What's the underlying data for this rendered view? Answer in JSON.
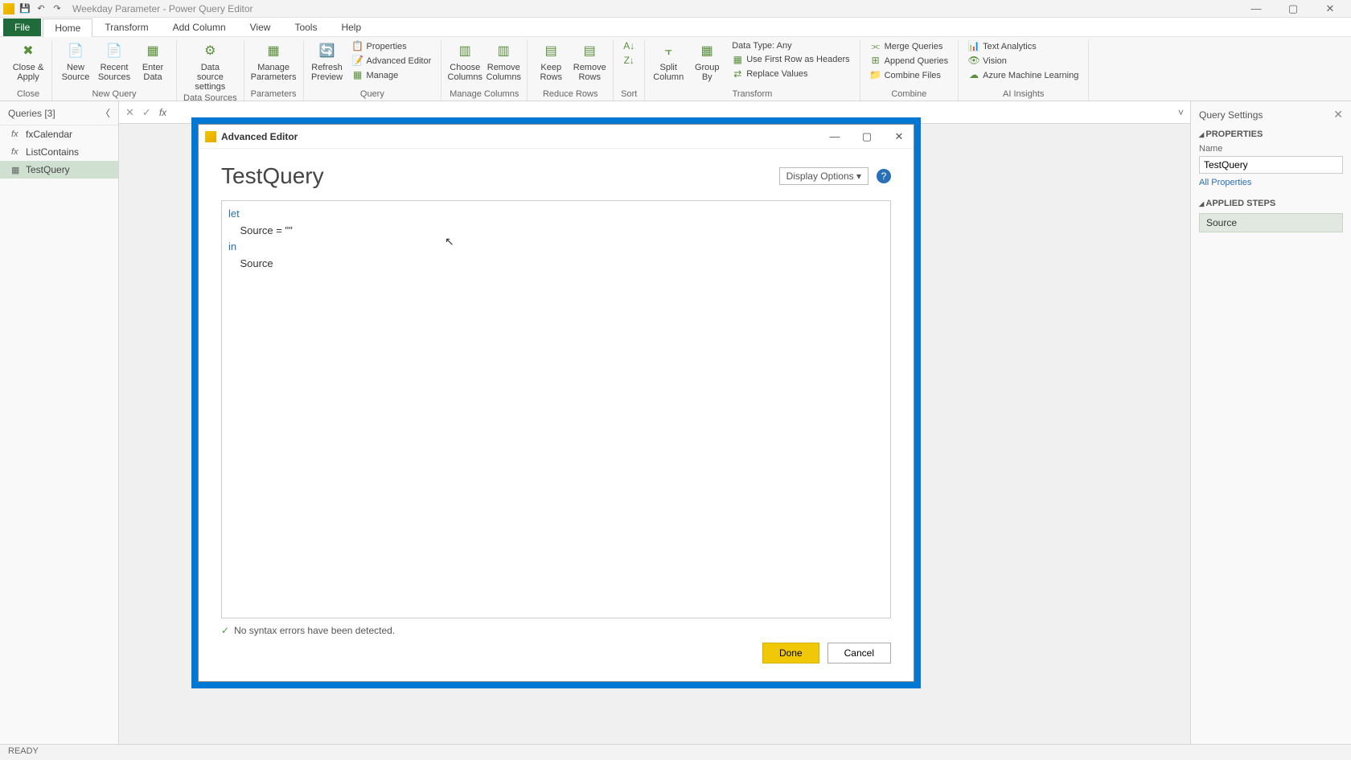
{
  "titlebar": {
    "title": "Weekday Parameter - Power Query Editor"
  },
  "tabs": {
    "file": "File",
    "home": "Home",
    "transform": "Transform",
    "addcolumn": "Add Column",
    "view": "View",
    "tools": "Tools",
    "help": "Help"
  },
  "ribbon": {
    "close_apply": "Close &\nApply",
    "new_source": "New\nSource",
    "recent_sources": "Recent\nSources",
    "enter_data": "Enter\nData",
    "data_source_settings": "Data source\nsettings",
    "manage_parameters": "Manage\nParameters",
    "refresh_preview": "Refresh\nPreview",
    "properties": "Properties",
    "advanced_editor": "Advanced Editor",
    "manage": "Manage",
    "choose_columns": "Choose\nColumns",
    "remove_columns": "Remove\nColumns",
    "keep_rows": "Keep\nRows",
    "remove_rows": "Remove\nRows",
    "sort_group": "Sort",
    "split_column": "Split\nColumn",
    "group_by": "Group\nBy",
    "data_type": "Data Type: Any",
    "first_row_headers": "Use First Row as Headers",
    "replace_values": "Replace Values",
    "merge_queries": "Merge Queries",
    "append_queries": "Append Queries",
    "combine_files": "Combine Files",
    "text_analytics": "Text Analytics",
    "vision": "Vision",
    "azure_ml": "Azure Machine Learning",
    "groups": {
      "close": "Close",
      "new_query": "New Query",
      "data_sources": "Data Sources",
      "parameters": "Parameters",
      "query": "Query",
      "manage_columns": "Manage Columns",
      "reduce_rows": "Reduce Rows",
      "sort": "Sort",
      "transform": "Transform",
      "combine": "Combine",
      "ai_insights": "AI Insights"
    }
  },
  "queries": {
    "header": "Queries [3]",
    "items": [
      {
        "name": "fxCalendar",
        "type": "fx"
      },
      {
        "name": "ListContains",
        "type": "fx"
      },
      {
        "name": "TestQuery",
        "type": "table"
      }
    ]
  },
  "settings": {
    "title": "Query Settings",
    "properties": "PROPERTIES",
    "name_label": "Name",
    "name_value": "TestQuery",
    "all_properties": "All Properties",
    "applied_steps": "APPLIED STEPS",
    "step0": "Source"
  },
  "dialog": {
    "title": "Advanced Editor",
    "heading": "TestQuery",
    "display_options": "Display Options",
    "code_let": "let",
    "code_source_assign": "    Source = \"\"",
    "code_in": "in",
    "code_source": "    Source",
    "status": "No syntax errors have been detected.",
    "done": "Done",
    "cancel": "Cancel"
  },
  "statusbar": "READY"
}
